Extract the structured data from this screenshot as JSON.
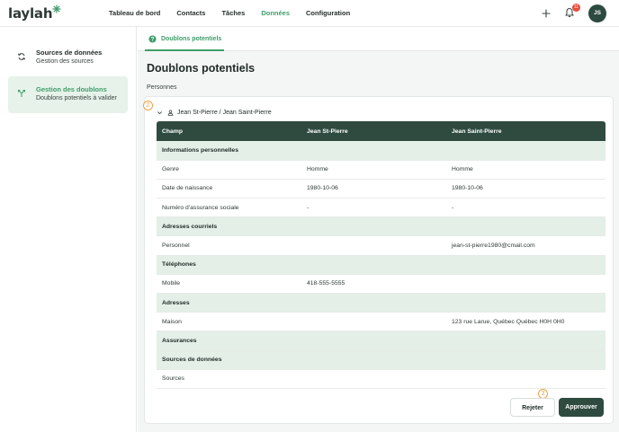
{
  "app": {
    "logo": "laylah"
  },
  "nav": {
    "items": [
      {
        "label": "Tableau de bord",
        "active": false
      },
      {
        "label": "Contacts",
        "active": false
      },
      {
        "label": "Tâches",
        "active": false
      },
      {
        "label": "Données",
        "active": true
      },
      {
        "label": "Configuration",
        "active": false
      }
    ]
  },
  "header": {
    "notifications_count": "11",
    "avatar_initials": "JS"
  },
  "sidebar": {
    "items": [
      {
        "title": "Sources de données",
        "subtitle": "Gestion des sources",
        "icon": "sync-icon",
        "active": false
      },
      {
        "title": "Gestion des doublons",
        "subtitle": "Doublons potentiels à valider",
        "icon": "merge-icon",
        "active": true
      }
    ]
  },
  "tabs": [
    {
      "label": "Doublons potentiels",
      "active": true
    }
  ],
  "page": {
    "title": "Doublons potentiels",
    "section": "Personnes"
  },
  "markers": {
    "pair": "2",
    "action": "3"
  },
  "pair": {
    "label": "Jean St-Pierre / Jean Saint-Pierre"
  },
  "table": {
    "headers": [
      "Champ",
      "Jean St-Pierre",
      "Jean Saint-Pierre"
    ],
    "rows": [
      {
        "type": "section",
        "cells": [
          "Informations personnelles",
          "",
          ""
        ]
      },
      {
        "type": "data",
        "cells": [
          "Genre",
          "Homme",
          "Homme"
        ]
      },
      {
        "type": "data",
        "cells": [
          "Date de naissance",
          "1980-10-06",
          "1980-10-06"
        ]
      },
      {
        "type": "data",
        "cells": [
          "Numéro d'assurance sociale",
          "-",
          "-"
        ]
      },
      {
        "type": "section",
        "cells": [
          "Adresses courriels",
          "",
          ""
        ]
      },
      {
        "type": "data",
        "cells": [
          "Personnel",
          "",
          "jean-st-pierre1980@cmail.com"
        ]
      },
      {
        "type": "section",
        "cells": [
          "Téléphones",
          "",
          ""
        ]
      },
      {
        "type": "data",
        "cells": [
          "Mobile",
          "418-555-5555",
          ""
        ]
      },
      {
        "type": "section",
        "cells": [
          "Adresses",
          "",
          ""
        ]
      },
      {
        "type": "data",
        "cells": [
          "Maison",
          "",
          "123 rue Larue, Québec Québec H0H 0H0"
        ]
      },
      {
        "type": "section",
        "cells": [
          "Assurances",
          "",
          ""
        ]
      },
      {
        "type": "section",
        "cells": [
          "Sources de données",
          "",
          ""
        ]
      },
      {
        "type": "data",
        "cells": [
          "Sources",
          "",
          ""
        ]
      }
    ]
  },
  "actions": {
    "reject_label": "Rejeter",
    "approve_label": "Approuver"
  },
  "colors": {
    "accent": "#3f9e6a",
    "header_dark": "#2f4b40",
    "section_bg": "#e3efe7",
    "marker": "#f0a045",
    "badge": "#e74c3c"
  }
}
